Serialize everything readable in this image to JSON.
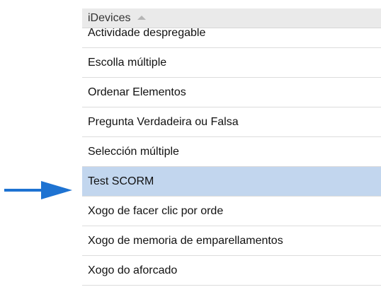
{
  "idevices_panel": {
    "header_label": "iDevices",
    "sort_icon": "sort-ascending-icon",
    "items": [
      {
        "label": "Actividade despregable",
        "selected": false
      },
      {
        "label": "Escolla múltiple",
        "selected": false
      },
      {
        "label": "Ordenar Elementos",
        "selected": false
      },
      {
        "label": "Pregunta Verdadeira ou Falsa",
        "selected": false
      },
      {
        "label": "Selección múltiple",
        "selected": false
      },
      {
        "label": "Test SCORM",
        "selected": true
      },
      {
        "label": "Xogo de facer clic por orde",
        "selected": false
      },
      {
        "label": "Xogo de memoria de emparellamentos",
        "selected": false
      },
      {
        "label": "Xogo do aforcado",
        "selected": false
      }
    ]
  },
  "colors": {
    "selected_row": "#c2d6ee",
    "header_bg": "#eaeaea",
    "arrow": "#1e73d2"
  },
  "annotation": {
    "icon": "right-arrow-icon"
  }
}
